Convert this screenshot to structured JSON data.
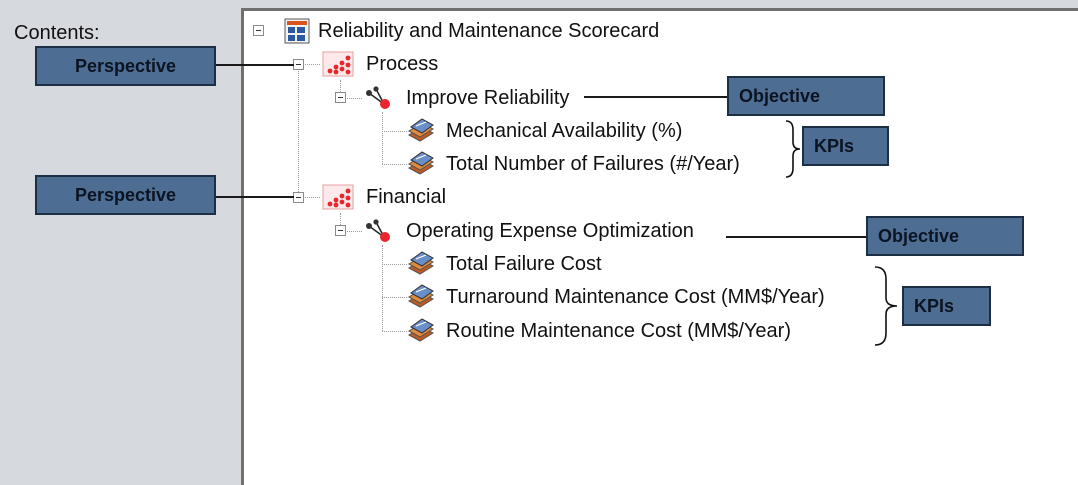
{
  "sidebar": {
    "contents_label": "Contents:"
  },
  "tree": {
    "root": {
      "label": "Reliability and Maintenance Scorecard",
      "icon": "scorecard-icon"
    },
    "perspectives": [
      {
        "label": "Process",
        "icon": "perspective-icon",
        "objective": {
          "label": "Improve Reliability",
          "icon": "objective-icon",
          "kpis": [
            {
              "label": "Mechanical Availability (%)",
              "icon": "kpi-icon"
            },
            {
              "label": "Total Number of Failures (#/Year)",
              "icon": "kpi-icon"
            }
          ]
        }
      },
      {
        "label": "Financial",
        "icon": "perspective-icon",
        "objective": {
          "label": "Operating Expense Optimization",
          "icon": "objective-icon",
          "kpis": [
            {
              "label": "Total Failure Cost",
              "icon": "kpi-icon"
            },
            {
              "label": "Turnaround Maintenance Cost (MM$/Year)",
              "icon": "kpi-icon"
            },
            {
              "label": "Routine Maintenance Cost (MM$/Year)",
              "icon": "kpi-icon"
            }
          ]
        }
      }
    ]
  },
  "callouts": {
    "perspective_1": "Perspective",
    "perspective_2": "Perspective",
    "objective_1": "Objective",
    "objective_2": "Objective",
    "kpis_1": "KPIs",
    "kpis_2": "KPIs"
  },
  "colors": {
    "callout_fill": "#4e6d92",
    "perspective_icon": "#e8262c",
    "objective_dot": "#e8262c"
  }
}
